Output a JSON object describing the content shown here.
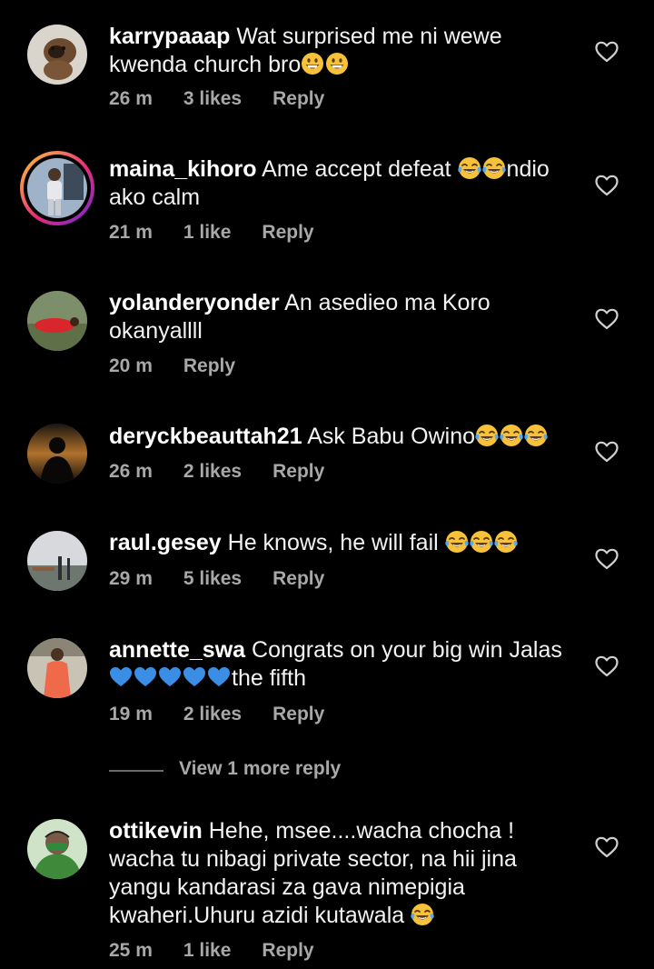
{
  "comments": [
    {
      "username": "karrypaaap",
      "text": "Wat surprised me ni wewe kwenda church bro",
      "emojis": [
        "grinning",
        "grinning"
      ],
      "time": "26 m",
      "likes": "3 likes",
      "reply": "Reply"
    },
    {
      "username": "maina_kihoro",
      "text": "Ame accept defeat ",
      "emojis": [
        "joy",
        "joy"
      ],
      "text_after": "ndio ako calm",
      "time": "21 m",
      "likes": "1 like",
      "reply": "Reply"
    },
    {
      "username": "yolanderyonder",
      "text": "An asedieo ma Koro okanyallll",
      "time": "20 m",
      "reply": "Reply"
    },
    {
      "username": "deryckbeauttah21",
      "text": "Ask Babu Owino",
      "emojis": [
        "joy",
        "joy",
        "joy"
      ],
      "time": "26 m",
      "likes": "2 likes",
      "reply": "Reply"
    },
    {
      "username": "raul.gesey",
      "text": "He knows, he will fail ",
      "emojis": [
        "joy",
        "joy",
        "joy"
      ],
      "time": "29 m",
      "likes": "5 likes",
      "reply": "Reply"
    },
    {
      "username": "annette_swa",
      "text": "Congrats on your big win Jalas ",
      "emojis": [
        "blue-heart",
        "blue-heart",
        "blue-heart",
        "blue-heart",
        "blue-heart"
      ],
      "text_after": "the fifth",
      "time": "19 m",
      "likes": "2 likes",
      "reply": "Reply"
    },
    {
      "username": "ottikevin",
      "text": "Hehe, msee....wacha chocha ! wacha tu nibagi private sector, na hii jina yangu kandarasi za gava nimepigia kwaheri.Uhuru azidi kutawala ",
      "emojis": [
        "joy"
      ],
      "time": "25 m",
      "likes": "1 like",
      "reply": "Reply"
    }
  ],
  "view_more": "View 1 more reply",
  "icons": {
    "like": "heart-outline-icon",
    "joy": "face-with-tears-of-joy",
    "grinning": "grinning-face",
    "blue_heart": "blue-heart"
  },
  "colors": {
    "background": "#000000",
    "text": "#f2f2f2",
    "meta": "#a8a8a8",
    "emoji_yellow": "#f7c23a",
    "tears_blue": "#5aa9e6",
    "blue_heart": "#3a8ee6"
  }
}
